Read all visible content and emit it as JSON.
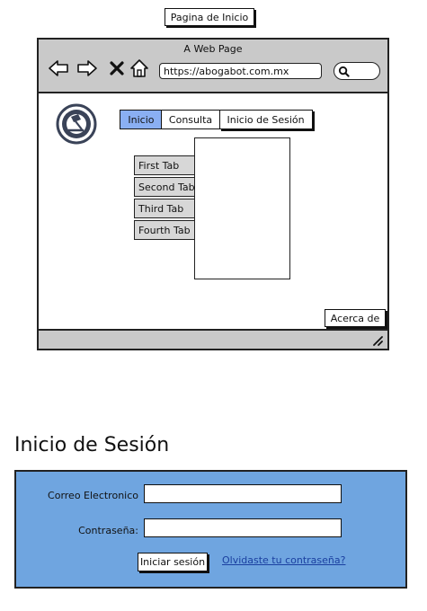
{
  "top_button": {
    "label": "Pagina de Inicio"
  },
  "browser": {
    "title": "A Web Page",
    "url": "https://abogabot.com.mx",
    "nav_tabs": [
      {
        "label": "Inicio",
        "active": true
      },
      {
        "label": "Consulta",
        "active": false
      },
      {
        "label": "Inicio de Sesión",
        "active": false
      }
    ],
    "vertical_tabs": [
      "First Tab",
      "Second Tab",
      "Third Tab",
      "Fourth Tab"
    ],
    "about_button": "Acerca de",
    "icons": [
      "back-icon",
      "forward-icon",
      "close-icon",
      "home-icon",
      "search-icon",
      "logo-icon",
      "resize-icon"
    ]
  },
  "login": {
    "title": "Inicio de Sesión",
    "email_label": "Correo Electronico",
    "email_value": "",
    "password_label": "Contraseña:",
    "password_value": "",
    "submit_label": "Iniciar sesión",
    "forgot_link": "Olvidaste tu contraseña?"
  },
  "colors": {
    "active_tab": "#8aaff3",
    "form_bg": "#6fa5e0",
    "chrome_gray": "#c9c9c9"
  }
}
